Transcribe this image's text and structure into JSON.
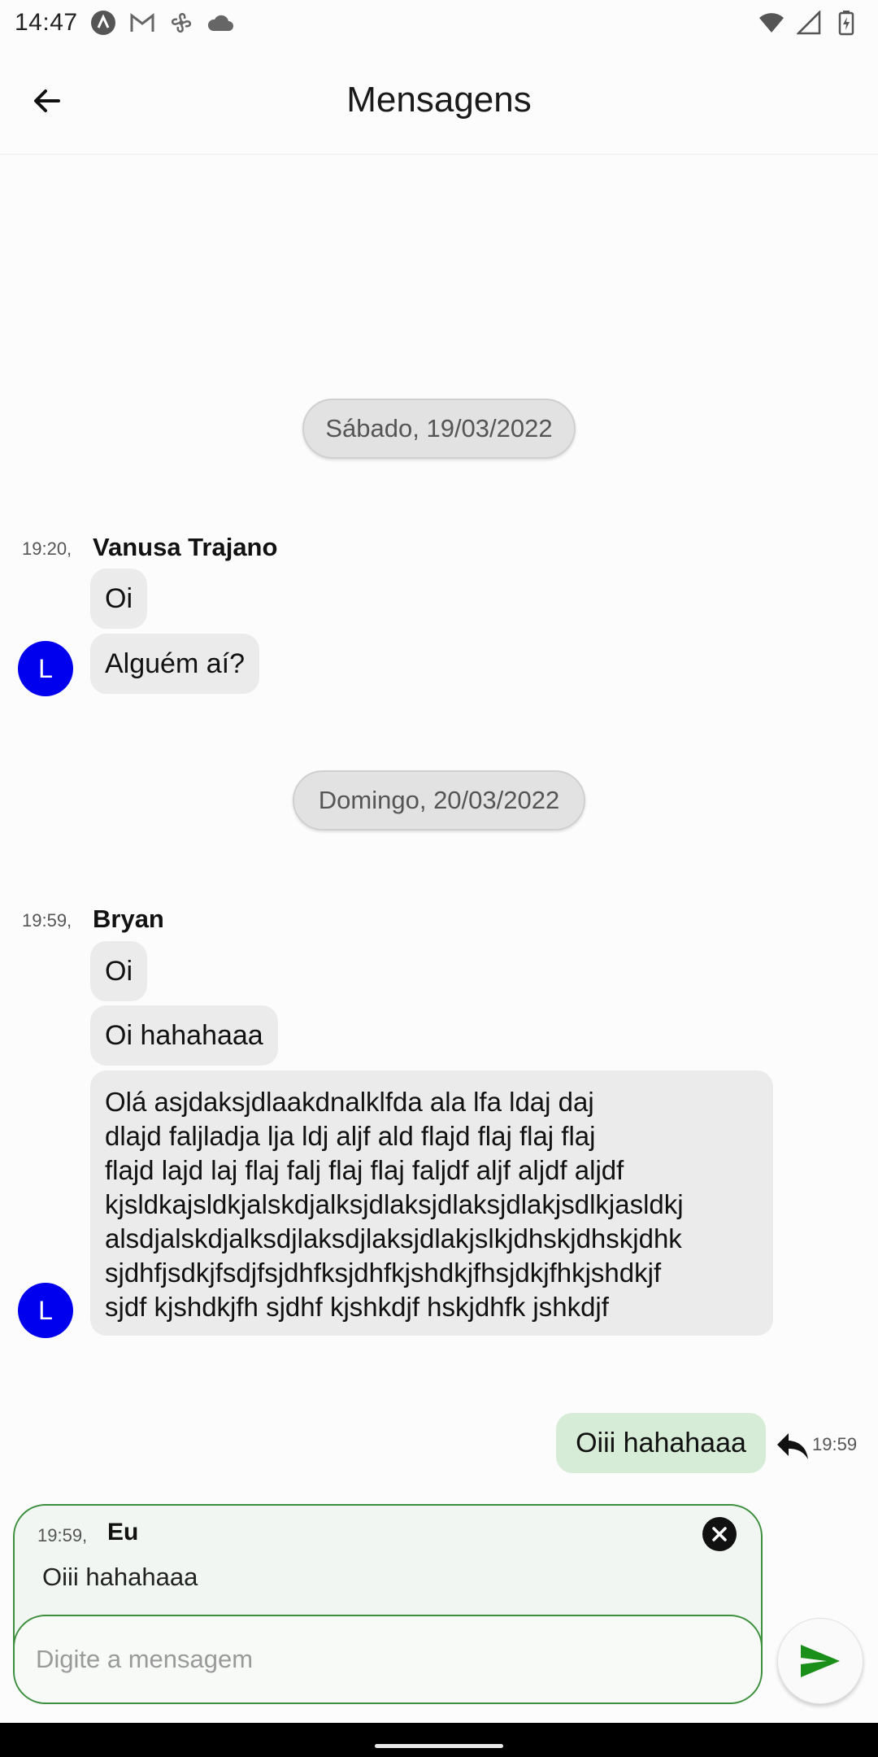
{
  "status_bar": {
    "time": "14:47",
    "notification_icons": [
      "app-circle-icon",
      "gmail-icon",
      "fan-icon",
      "cloud-icon"
    ],
    "system_icons": [
      "wifi-icon",
      "signal-icon",
      "battery-charging-icon"
    ]
  },
  "app_bar": {
    "title": "Mensagens",
    "back_icon": "arrow-left-icon"
  },
  "colors": {
    "accent": "#2e8b2e",
    "avatar": "#0000ee",
    "bubble_other": "#ebebeb",
    "bubble_mine": "#d6ecd6"
  },
  "conversation": {
    "day1": {
      "date": "Sábado, 19/03/2022",
      "time": "19:20,",
      "sender": "Vanusa Trajano",
      "avatar_letter": "L",
      "messages": [
        "Oi",
        "Alguém aí?"
      ]
    },
    "day2": {
      "date": "Domingo, 20/03/2022",
      "time": "19:59,",
      "sender": "Bryan",
      "avatar_letter": "L",
      "messages": [
        "Oi",
        "Oi hahahaaa",
        "Olá asjdaksjdlaakdnalklfda ala lfa ldaj daj\ndlajd faljladja lja ldj aljf ald flajd flaj flaj flaj\nflajd lajd laj flaj falj flaj flaj faljdf aljf aljdf aljdf\nkjsldkajsldkjalskdjalksjdlaksjdlaksjdlakjsdlkjasldkj\nalsdjalskdjalksdjlaksdjlaksjdlakjslkjdhskjdhskjdhk\nsjdhfjsdkjfsdjfsjdhfksjdhfkjshdkjfhsjdkjfhkjshdkjf\nsjdf kjshdkjfh sjdhf kjshkdjf hskjdhfk jshkdjf"
      ]
    },
    "my_message": {
      "text": "Oiii hahahaaa",
      "time": "19:59"
    }
  },
  "composer": {
    "reply_preview": {
      "time": "19:59,",
      "sender": "Eu",
      "text": "Oiii hahahaaa"
    },
    "input_placeholder": "Digite a mensagem",
    "input_value": ""
  }
}
